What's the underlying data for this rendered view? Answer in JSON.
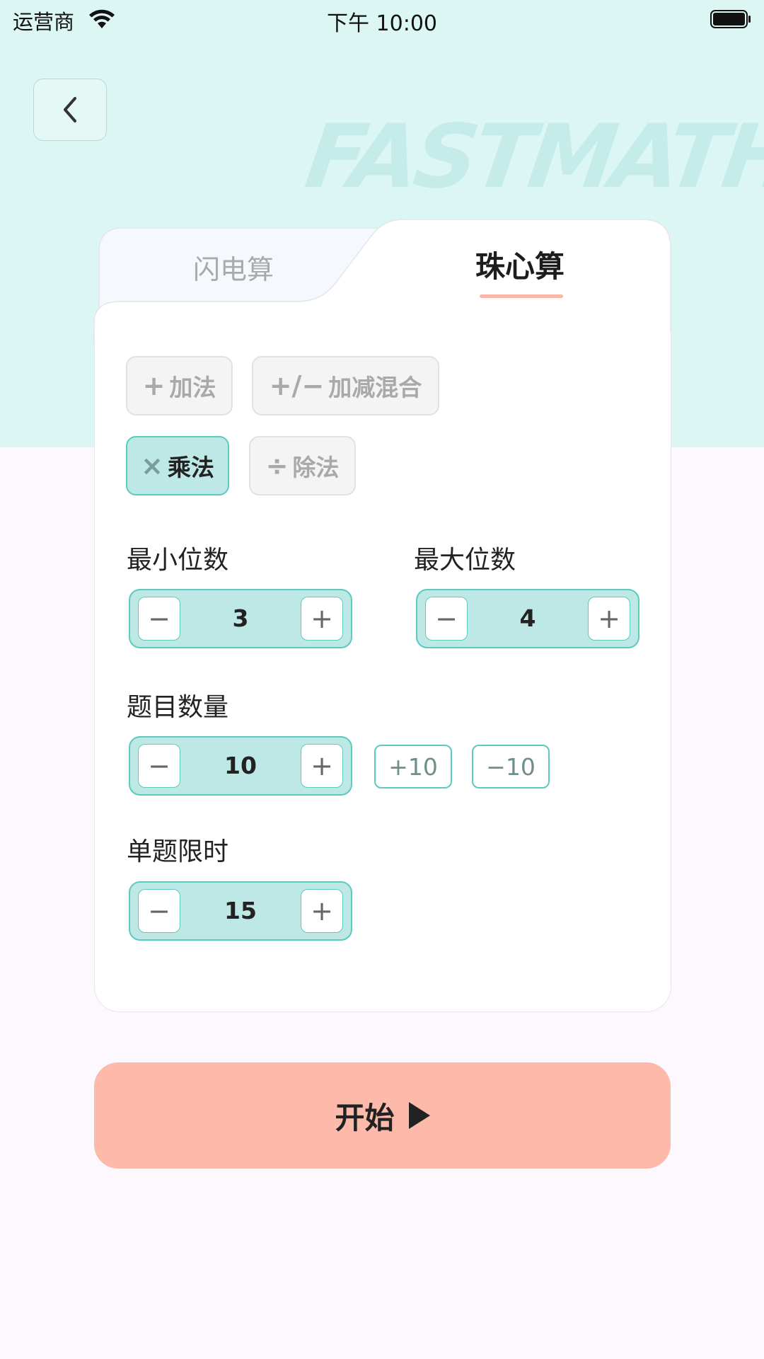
{
  "status_bar": {
    "carrier": "运营商",
    "time": "下午 10:00"
  },
  "header": {
    "watermark": "FASTMATH"
  },
  "tabs": [
    {
      "label": "闪电算",
      "active": false
    },
    {
      "label": "珠心算",
      "active": true
    }
  ],
  "operations": [
    {
      "symbol": "+",
      "label": "加法",
      "selected": false
    },
    {
      "symbol": "+/−",
      "label": "加减混合",
      "selected": false
    },
    {
      "symbol": "×",
      "label": "乘法",
      "selected": true
    },
    {
      "symbol": "÷",
      "label": "除法",
      "selected": false
    }
  ],
  "settings": {
    "min_digits": {
      "label": "最小位数",
      "value": "3"
    },
    "max_digits": {
      "label": "最大位数",
      "value": "4"
    },
    "question_count": {
      "label": "题目数量",
      "value": "10",
      "plus_ten": "+10",
      "minus_ten": "−10"
    },
    "time_limit": {
      "label": "单题限时",
      "value": "15"
    }
  },
  "stepper_symbols": {
    "minus": "−",
    "plus": "+"
  },
  "start_button": {
    "label": "开始"
  },
  "colors": {
    "accent": "#5ccabe",
    "selected_fill": "#bde8e6",
    "start": "#fdb9aa",
    "header_bg": "#dcf6f4"
  }
}
